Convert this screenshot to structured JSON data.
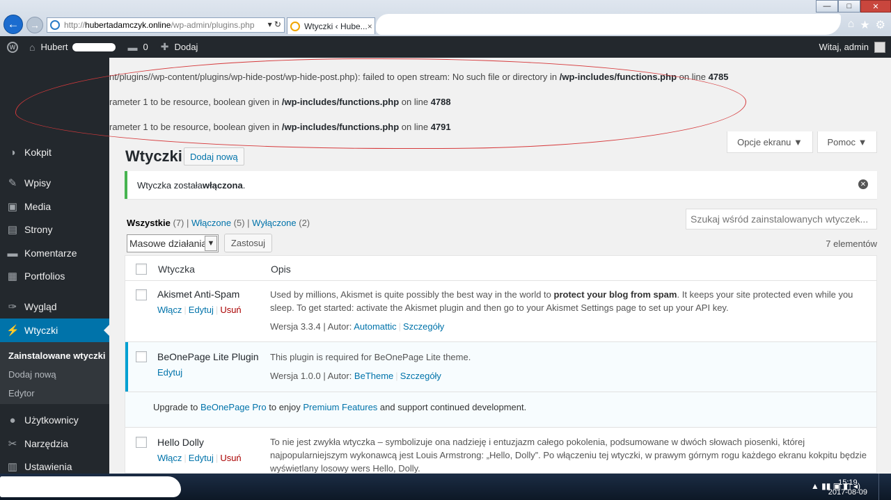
{
  "browser": {
    "url_prefix": "http://",
    "url_domain": "hubertadamczyk.online",
    "url_path": "/wp-admin/plugins.php",
    "url_controls": "▾ ↻",
    "tab_title": "Wtyczki ‹ Hube...",
    "tab_close": "×",
    "win_minimize": "—",
    "win_maximize": "□",
    "win_close": "✕",
    "icon_home": "⌂",
    "icon_favorites": "★",
    "icon_settings": "⚙"
  },
  "adminbar": {
    "site_name": "Hubert",
    "comments_count": "0",
    "new_label": "Dodaj",
    "howdy": "Witaj, admin"
  },
  "errors": [
    {
      "text": "nt/plugins//wp-content/plugins/wp-hide-post/wp-hide-post.php): failed to open stream: No such file or directory in ",
      "file": "/wp-includes/functions.php",
      "mid": " on line ",
      "line": "4785"
    },
    {
      "text": "rameter 1 to be resource, boolean given in ",
      "file": "/wp-includes/functions.php",
      "mid": " on line ",
      "line": "4788"
    },
    {
      "text": "rameter 1 to be resource, boolean given in ",
      "file": "/wp-includes/functions.php",
      "mid": " on line ",
      "line": "4791"
    }
  ],
  "screen_options": {
    "screen": "Opcje ekranu ▼",
    "help": "Pomoc ▼"
  },
  "sidebar": {
    "items": [
      {
        "label": "Kokpit",
        "icon": "dashboard-icon",
        "glyph": "◑"
      },
      {
        "label": "Wpisy",
        "icon": "pin-icon",
        "glyph": "✎"
      },
      {
        "label": "Media",
        "icon": "media-icon",
        "glyph": "▣"
      },
      {
        "label": "Strony",
        "icon": "pages-icon",
        "glyph": "▤"
      },
      {
        "label": "Komentarze",
        "icon": "comment-icon",
        "glyph": "▬"
      },
      {
        "label": "Portfolios",
        "icon": "portfolio-icon",
        "glyph": "▦"
      },
      {
        "label": "Wygląd",
        "icon": "brush-icon",
        "glyph": "✑"
      },
      {
        "label": "Wtyczki",
        "icon": "plugin-icon",
        "glyph": "⚡"
      },
      {
        "label": "Użytkownicy",
        "icon": "users-icon",
        "glyph": "●"
      },
      {
        "label": "Narzędzia",
        "icon": "tools-icon",
        "glyph": "✂"
      },
      {
        "label": "Ustawienia",
        "icon": "settings-icon",
        "glyph": "▥"
      }
    ],
    "submenu": [
      "Zainstalowane wtyczki",
      "Dodaj nową",
      "Edytor"
    ]
  },
  "page": {
    "title": "Wtyczki",
    "add_new": "Dodaj nową",
    "notice_pre": "Wtyczka została ",
    "notice_bold": "włączona",
    "notice_post": ".",
    "filter_all": "Wszystkie",
    "filter_all_count": " (7)",
    "filter_active": "Włączone",
    "filter_active_count": " (5)",
    "filter_inactive": "Wyłączone",
    "filter_inactive_count": " (2)",
    "filter_sep": " | ",
    "search_placeholder": "Szukaj wśród zainstalowanych wtyczek...",
    "bulk_actions": "Masowe działania",
    "apply": "Zastosuj",
    "items_count": "7 elementów"
  },
  "table": {
    "col_plugin": "Wtyczka",
    "col_desc": "Opis",
    "plugins": [
      {
        "name": "Akismet Anti-Spam",
        "actions": [
          "Włącz",
          "Edytuj",
          "Usuń"
        ],
        "desc_pre": "Used by millions, Akismet is quite possibly the best way in the world to ",
        "desc_bold": "protect your blog from spam",
        "desc_post": ". It keeps your site protected even while you sleep. To get started: activate the Akismet plugin and then go to your Akismet Settings page to set up your API key.",
        "version": "Wersja 3.3.4 | Autor: ",
        "author": "Automattic",
        "details": "Szczegóły"
      },
      {
        "name": "BeOnePage Lite Plugin",
        "actions": [
          "Edytuj"
        ],
        "desc": "This plugin is required for BeOnePage Lite theme.",
        "version": "Wersja 1.0.0 | Autor: ",
        "author": "BeTheme",
        "details": "Szczegóły",
        "upgrade_pre": "Upgrade to ",
        "upgrade_link1": "BeOnePage Pro",
        "upgrade_mid": " to enjoy ",
        "upgrade_link2": "Premium Features",
        "upgrade_post": " and support continued development."
      },
      {
        "name": "Hello Dolly",
        "actions": [
          "Włącz",
          "Edytuj",
          "Usuń"
        ],
        "desc": "To nie jest zwykła wtyczka – symbolizuje ona nadzieję i entuzjazm całego pokolenia, podsumowane w dwóch słowach piosenki, której najpopularniejszym wykonawcą jest Louis Armstrong: „Hello, Dolly”. Po włączeniu tej wtyczki, w prawym górnym rogu każdego ekranu kokpitu będzie wyświetlany losowy wers Hello, Dolly."
      }
    ]
  },
  "taskbar": {
    "time": "15:19",
    "date": "2017-08-09",
    "tray": "▲ ▮▮ ▣ ◧ ◂)"
  }
}
